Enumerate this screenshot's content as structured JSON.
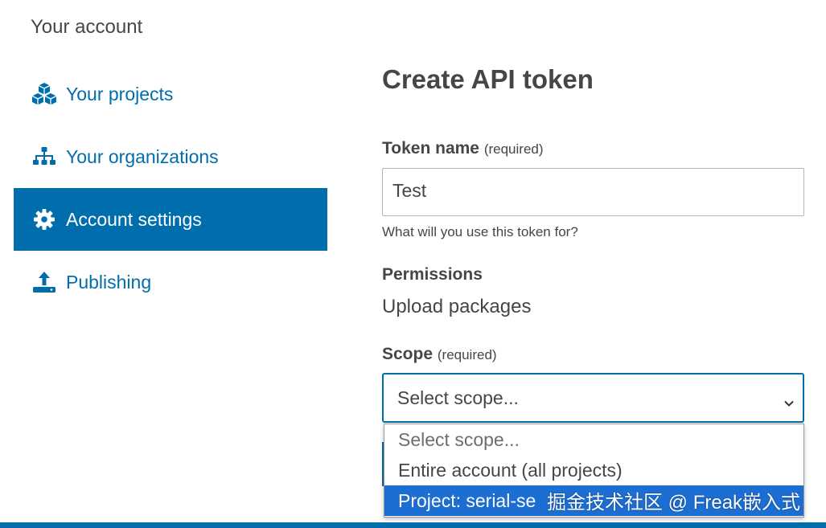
{
  "sidebar": {
    "title": "Your account",
    "items": [
      {
        "label": "Your projects",
        "icon": "cubes-icon",
        "active": false
      },
      {
        "label": "Your organizations",
        "icon": "sitemap-icon",
        "active": false
      },
      {
        "label": "Account settings",
        "icon": "gear-icon",
        "active": true
      },
      {
        "label": "Publishing",
        "icon": "upload-icon",
        "active": false
      }
    ]
  },
  "main": {
    "title": "Create API token",
    "token_name": {
      "label": "Token name",
      "required": "(required)",
      "value": "Test",
      "help": "What will you use this token for?"
    },
    "permissions": {
      "label": "Permissions",
      "value": "Upload packages"
    },
    "scope": {
      "label": "Scope",
      "required": "(required)",
      "selected": "Select scope...",
      "options": [
        "Select scope...",
        "Entire account (all projects)",
        "Project: serial-se"
      ],
      "highlighted_index": 2
    }
  },
  "watermark": "掘金技术社区 @ Freak嵌入式",
  "colors": {
    "accent": "#006dad",
    "option_highlight": "#1c6ed3",
    "text": "#464646"
  }
}
